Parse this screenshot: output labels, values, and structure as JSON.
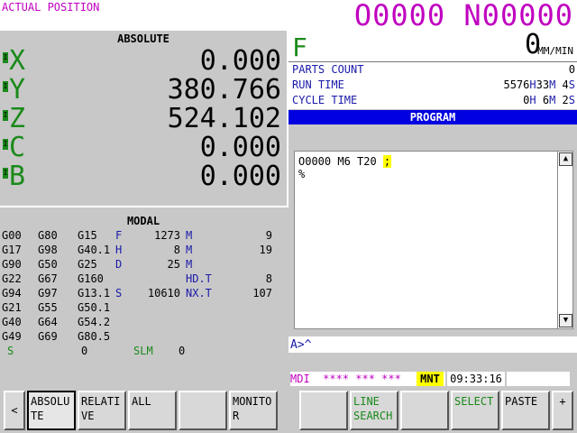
{
  "header": {
    "title": "ACTUAL POSITION",
    "program": "O0000 N00000"
  },
  "position": {
    "title": "ABSOLUTE",
    "axes": [
      {
        "mark": "I",
        "name": "X",
        "value": "0.000"
      },
      {
        "mark": "I",
        "name": "Y",
        "value": "380.766"
      },
      {
        "mark": "I",
        "name": "Z",
        "value": "524.102"
      },
      {
        "mark": "I",
        "name": "C",
        "value": "0.000"
      },
      {
        "mark": "I",
        "name": "B",
        "value": "0.000"
      }
    ]
  },
  "modal": {
    "title": "MODAL",
    "rows": [
      [
        "G00",
        "G80",
        "G15",
        "F",
        "1273",
        "M",
        "9"
      ],
      [
        "G17",
        "G98",
        "G40.1",
        "H",
        "8",
        "M",
        "19"
      ],
      [
        "G90",
        "G50",
        "G25",
        "D",
        "25",
        "M",
        ""
      ],
      [
        "G22",
        "G67",
        "G160",
        "",
        "",
        "HD.T",
        "8"
      ],
      [
        "G94",
        "G97",
        "G13.1",
        "S",
        "10610",
        "NX.T",
        "107"
      ],
      [
        "G21",
        "G55",
        "G50.1",
        "",
        "",
        "",
        ""
      ],
      [
        "G40",
        "G64",
        "G54.2",
        "",
        "",
        "",
        ""
      ],
      [
        "G49",
        "G69",
        "G80.5",
        "",
        "",
        "",
        ""
      ]
    ],
    "footer": {
      "s_label": "S",
      "s_value": "0",
      "slm_label": "SLM",
      "slm_value": "0"
    }
  },
  "feed": {
    "letter": "F",
    "value": "0",
    "unit": "MM/MIN"
  },
  "stats": {
    "parts_count": {
      "label": "PARTS COUNT",
      "value": "0"
    },
    "run_time": {
      "label": "RUN TIME",
      "h": "5576",
      "h_unit": "H",
      "m": "33",
      "m_unit": "M",
      "s": "4",
      "s_unit": "S"
    },
    "cycle_time": {
      "label": "CYCLE TIME",
      "h": "0",
      "h_unit": "H",
      "m": "6",
      "m_unit": "M",
      "s": "2",
      "s_unit": "S"
    }
  },
  "program": {
    "title": "PROGRAM",
    "line1": "O0000 M6 T20 ",
    "line1_cursor": ";",
    "line2": "%"
  },
  "input_prompt": "A>^",
  "status": {
    "mode": "MDI  **** *** ***",
    "mnt": "MNT",
    "time": "09:33:16"
  },
  "softkeys": {
    "left_arrow": "<",
    "absolute": "ABSOLU TE",
    "relative": "RELATI VE",
    "all": "ALL",
    "blank1": "",
    "monitor": "MONITO R",
    "blank2": "",
    "line_search": "LINE SEARCH",
    "blank3": "",
    "select": "SELECT",
    "paste": "PASTE",
    "plus": "+"
  },
  "colors": {
    "magenta": "#c000c0",
    "green": "#1a8a1a",
    "blue": "#1a1aaa",
    "program_bar": "#0000e0",
    "highlight": "#ffff00"
  }
}
